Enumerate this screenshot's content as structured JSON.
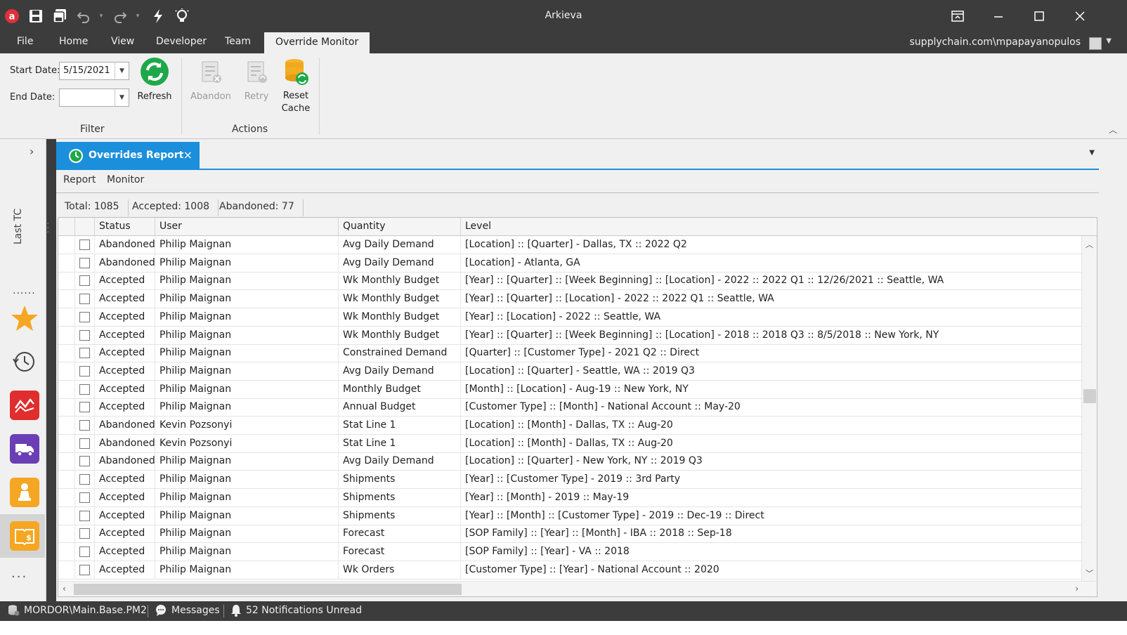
{
  "app": {
    "title": "Arkieva",
    "account": "supplychain.com\\mpapayanopulos"
  },
  "menu": {
    "file": "File",
    "home": "Home",
    "view": "View",
    "developer": "Developer",
    "team": "Team",
    "override_monitor": "Override Monitor"
  },
  "ribbon": {
    "start_date_label": "Start Date:",
    "start_date_value": "5/15/2021",
    "end_date_label": "End Date:",
    "end_date_value": "",
    "refresh": "Refresh",
    "abandon": "Abandon",
    "retry": "Retry",
    "reset": "Reset",
    "cache": "Cache",
    "filter_group": "Filter",
    "actions_group": "Actions"
  },
  "rail": {
    "last_tc": "Last TC",
    "dots": "......",
    "more": "..."
  },
  "doc_tab": {
    "title": "Overrides Report",
    "close": "×"
  },
  "subtabs": {
    "report": "Report",
    "monitor": "Monitor"
  },
  "stats": {
    "total": "Total: 1085",
    "accepted": "Accepted: 1008",
    "abandoned": "Abandoned: 77"
  },
  "grid": {
    "columns": {
      "status": "Status",
      "user": "User",
      "quantity": "Quantity",
      "level": "Level"
    },
    "rows": [
      {
        "status": "Abandoned",
        "user": "Philip Maignan",
        "quantity": "Avg Daily Demand",
        "level": "[Location] :: [Quarter] - Dallas, TX :: 2022 Q2"
      },
      {
        "status": "Abandoned",
        "user": "Philip Maignan",
        "quantity": "Avg Daily Demand",
        "level": "[Location] - Atlanta, GA"
      },
      {
        "status": "Accepted",
        "user": "Philip Maignan",
        "quantity": "Wk Monthly Budget",
        "level": "[Year] :: [Quarter] :: [Week Beginning] :: [Location] - 2022 :: 2022 Q1 :: 12/26/2021 :: Seattle, WA"
      },
      {
        "status": "Accepted",
        "user": "Philip Maignan",
        "quantity": "Wk Monthly Budget",
        "level": "[Year] :: [Quarter] :: [Location] - 2022 :: 2022 Q1 :: Seattle, WA"
      },
      {
        "status": "Accepted",
        "user": "Philip Maignan",
        "quantity": "Wk Monthly Budget",
        "level": "[Year] :: [Location] - 2022 :: Seattle, WA"
      },
      {
        "status": "Accepted",
        "user": "Philip Maignan",
        "quantity": "Wk Monthly Budget",
        "level": "[Year] :: [Quarter] :: [Week Beginning] :: [Location] - 2018 :: 2018 Q3 :: 8/5/2018 :: New York, NY"
      },
      {
        "status": "Accepted",
        "user": "Philip Maignan",
        "quantity": "Constrained Demand",
        "level": "[Quarter] :: [Customer Type] - 2021 Q2 :: Direct"
      },
      {
        "status": "Accepted",
        "user": "Philip Maignan",
        "quantity": "Avg Daily Demand",
        "level": "[Location] :: [Quarter] - Seattle, WA :: 2019 Q3"
      },
      {
        "status": "Accepted",
        "user": "Philip Maignan",
        "quantity": "Monthly Budget",
        "level": "[Month] :: [Location] - Aug-19 :: New York, NY"
      },
      {
        "status": "Accepted",
        "user": "Philip Maignan",
        "quantity": "Annual Budget",
        "level": "[Customer Type] :: [Month] - National Account :: May-20"
      },
      {
        "status": "Abandoned",
        "user": "Kevin Pozsonyi",
        "quantity": "Stat Line 1",
        "level": "[Location] :: [Month] - Dallas, TX :: Aug-20"
      },
      {
        "status": "Abandoned",
        "user": "Kevin Pozsonyi",
        "quantity": "Stat Line 1",
        "level": "[Location] :: [Month] - Dallas, TX :: Aug-20"
      },
      {
        "status": "Abandoned",
        "user": "Philip Maignan",
        "quantity": "Avg Daily Demand",
        "level": "[Location] :: [Quarter] - New York, NY :: 2019 Q3"
      },
      {
        "status": "Accepted",
        "user": "Philip Maignan",
        "quantity": "Shipments",
        "level": "[Year] :: [Customer Type] - 2019 :: 3rd Party"
      },
      {
        "status": "Accepted",
        "user": "Philip Maignan",
        "quantity": "Shipments",
        "level": "[Year] :: [Month] - 2019 :: May-19"
      },
      {
        "status": "Accepted",
        "user": "Philip Maignan",
        "quantity": "Shipments",
        "level": "[Year] :: [Month] :: [Customer Type] - 2019 :: Dec-19 :: Direct"
      },
      {
        "status": "Accepted",
        "user": "Philip Maignan",
        "quantity": "Forecast",
        "level": "[SOP Family] :: [Year] :: [Month] - IBA :: 2018 :: Sep-18"
      },
      {
        "status": "Accepted",
        "user": "Philip Maignan",
        "quantity": "Forecast",
        "level": "[SOP Family] :: [Year] - VA :: 2018"
      },
      {
        "status": "Accepted",
        "user": "Philip Maignan",
        "quantity": "Wk Orders",
        "level": "[Customer Type] :: [Year] - National Account :: 2020"
      }
    ]
  },
  "statusbar": {
    "database": "MORDOR\\Main.Base.PM2",
    "messages": "Messages",
    "notifications": "52 Notifications Unread"
  },
  "colors": {
    "accent": "#1b8fdc",
    "chrome": "#3c3c3c",
    "ribbon": "#f0f0f0"
  },
  "icons": {
    "app": "app-logo-icon",
    "save": "save-icon",
    "save_all": "save-all-icon",
    "undo": "undo-icon",
    "redo": "redo-icon",
    "flash": "lightning-icon",
    "idea": "lightbulb-icon",
    "refresh": "refresh-icon",
    "abandon": "abandon-icon",
    "retry": "retry-icon",
    "reset_cache": "database-refresh-icon"
  }
}
